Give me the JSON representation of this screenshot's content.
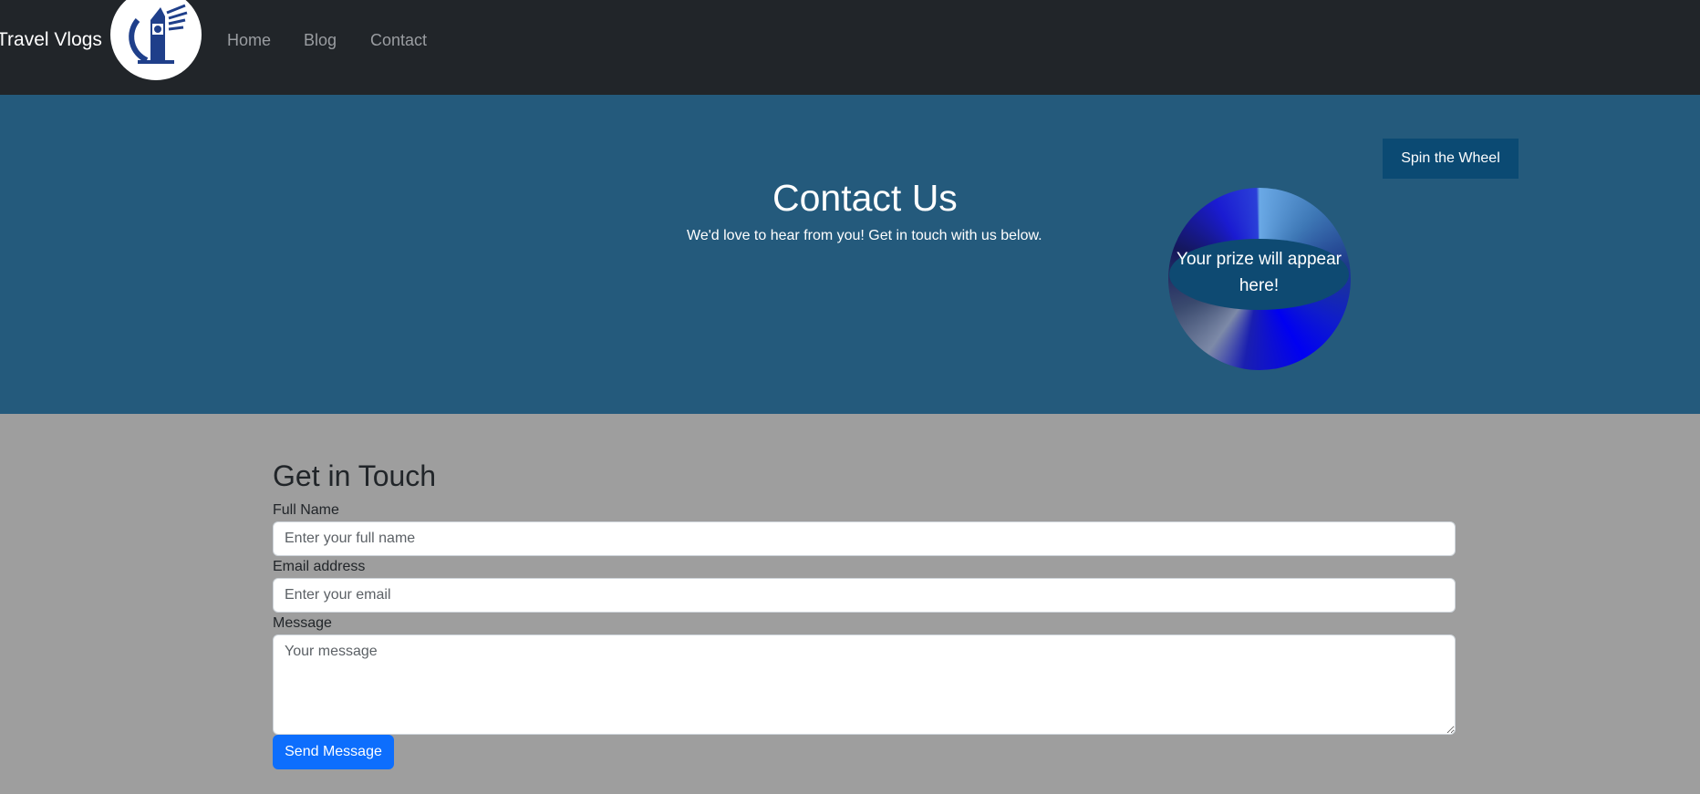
{
  "nav": {
    "brand": "Travel Vlogs",
    "logo_icon": "big-ben-clock-tower-icon",
    "links": [
      {
        "label": "Home"
      },
      {
        "label": "Blog"
      },
      {
        "label": "Contact"
      }
    ]
  },
  "hero": {
    "title": "Contact Us",
    "subtitle": "We'd love to hear from you! Get in touch with us below.",
    "spin_button": "Spin the Wheel",
    "prize_text": "Your prize will appear here!"
  },
  "form": {
    "title": "Get in Touch",
    "name_label": "Full Name",
    "name_placeholder": "Enter your full name",
    "name_value": "",
    "email_label": "Email address",
    "email_placeholder": "Enter your email",
    "email_value": "",
    "message_label": "Message",
    "message_placeholder": "Your message",
    "message_value": "",
    "submit": "Send Message"
  },
  "colors": {
    "navbar": "#212529",
    "hero": "#245a7c",
    "page": "#9e9e9e",
    "spin_button": "#0b4a73",
    "send_button": "#0d6efd"
  }
}
